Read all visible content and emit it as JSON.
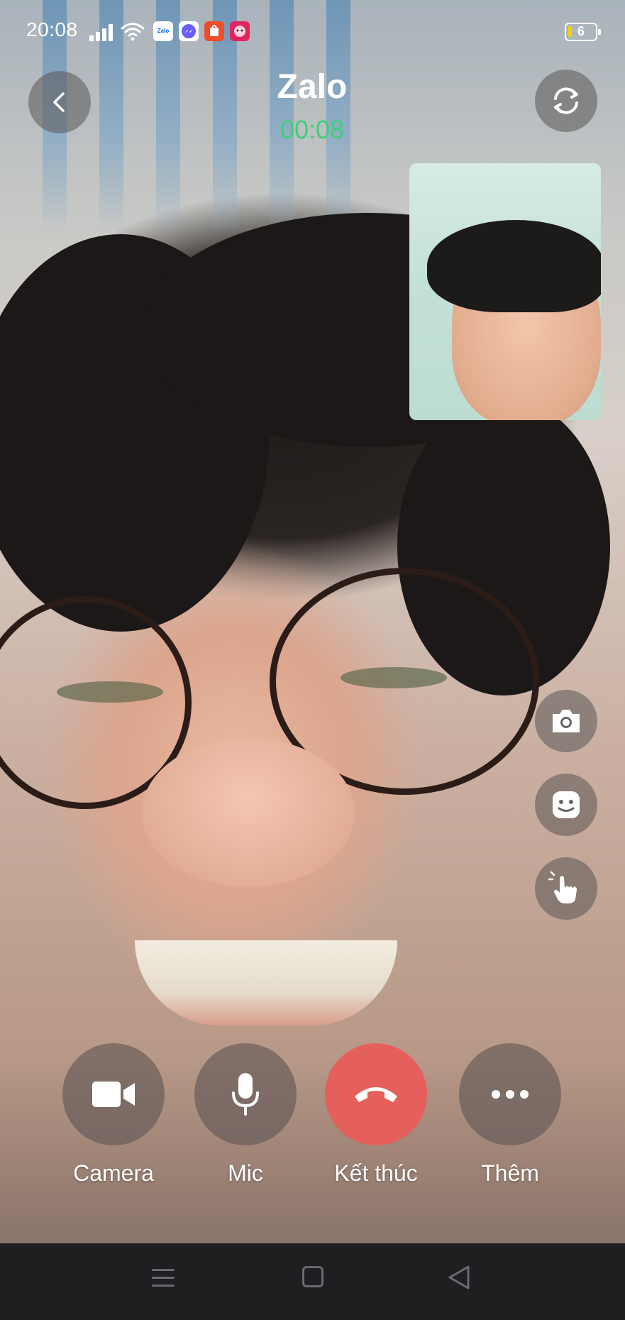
{
  "status_bar": {
    "time": "20:08",
    "battery_level": "6",
    "notification_apps": [
      "Zalo",
      "Messenger",
      "Shopee",
      "Lazada"
    ]
  },
  "call": {
    "title": "Zalo",
    "timer": "00:08",
    "timer_color": "#3ed07a"
  },
  "controls": {
    "camera_label": "Camera",
    "mic_label": "Mic",
    "end_call_label": "Kết thúc",
    "more_label": "Thêm",
    "end_call_color": "#e5605c"
  },
  "icons": {
    "back": "back-chevron-icon",
    "switch_camera": "switch-camera-icon",
    "snapshot": "camera-icon",
    "sticker": "face-sticker-icon",
    "gesture": "hand-gesture-icon",
    "video": "video-camera-icon",
    "mic": "microphone-icon",
    "end_call": "phone-hangup-icon",
    "more": "more-dots-icon"
  }
}
